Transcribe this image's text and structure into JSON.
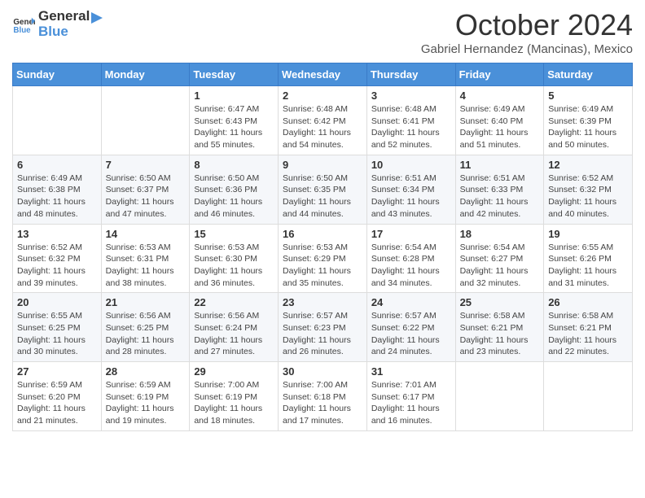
{
  "header": {
    "logo_general": "General",
    "logo_blue": "Blue",
    "month_title": "October 2024",
    "subtitle": "Gabriel Hernandez (Mancinas), Mexico"
  },
  "weekdays": [
    "Sunday",
    "Monday",
    "Tuesday",
    "Wednesday",
    "Thursday",
    "Friday",
    "Saturday"
  ],
  "weeks": [
    [
      {
        "day": "",
        "info": ""
      },
      {
        "day": "",
        "info": ""
      },
      {
        "day": "1",
        "info": "Sunrise: 6:47 AM\nSunset: 6:43 PM\nDaylight: 11 hours and 55 minutes."
      },
      {
        "day": "2",
        "info": "Sunrise: 6:48 AM\nSunset: 6:42 PM\nDaylight: 11 hours and 54 minutes."
      },
      {
        "day": "3",
        "info": "Sunrise: 6:48 AM\nSunset: 6:41 PM\nDaylight: 11 hours and 52 minutes."
      },
      {
        "day": "4",
        "info": "Sunrise: 6:49 AM\nSunset: 6:40 PM\nDaylight: 11 hours and 51 minutes."
      },
      {
        "day": "5",
        "info": "Sunrise: 6:49 AM\nSunset: 6:39 PM\nDaylight: 11 hours and 50 minutes."
      }
    ],
    [
      {
        "day": "6",
        "info": "Sunrise: 6:49 AM\nSunset: 6:38 PM\nDaylight: 11 hours and 48 minutes."
      },
      {
        "day": "7",
        "info": "Sunrise: 6:50 AM\nSunset: 6:37 PM\nDaylight: 11 hours and 47 minutes."
      },
      {
        "day": "8",
        "info": "Sunrise: 6:50 AM\nSunset: 6:36 PM\nDaylight: 11 hours and 46 minutes."
      },
      {
        "day": "9",
        "info": "Sunrise: 6:50 AM\nSunset: 6:35 PM\nDaylight: 11 hours and 44 minutes."
      },
      {
        "day": "10",
        "info": "Sunrise: 6:51 AM\nSunset: 6:34 PM\nDaylight: 11 hours and 43 minutes."
      },
      {
        "day": "11",
        "info": "Sunrise: 6:51 AM\nSunset: 6:33 PM\nDaylight: 11 hours and 42 minutes."
      },
      {
        "day": "12",
        "info": "Sunrise: 6:52 AM\nSunset: 6:32 PM\nDaylight: 11 hours and 40 minutes."
      }
    ],
    [
      {
        "day": "13",
        "info": "Sunrise: 6:52 AM\nSunset: 6:32 PM\nDaylight: 11 hours and 39 minutes."
      },
      {
        "day": "14",
        "info": "Sunrise: 6:53 AM\nSunset: 6:31 PM\nDaylight: 11 hours and 38 minutes."
      },
      {
        "day": "15",
        "info": "Sunrise: 6:53 AM\nSunset: 6:30 PM\nDaylight: 11 hours and 36 minutes."
      },
      {
        "day": "16",
        "info": "Sunrise: 6:53 AM\nSunset: 6:29 PM\nDaylight: 11 hours and 35 minutes."
      },
      {
        "day": "17",
        "info": "Sunrise: 6:54 AM\nSunset: 6:28 PM\nDaylight: 11 hours and 34 minutes."
      },
      {
        "day": "18",
        "info": "Sunrise: 6:54 AM\nSunset: 6:27 PM\nDaylight: 11 hours and 32 minutes."
      },
      {
        "day": "19",
        "info": "Sunrise: 6:55 AM\nSunset: 6:26 PM\nDaylight: 11 hours and 31 minutes."
      }
    ],
    [
      {
        "day": "20",
        "info": "Sunrise: 6:55 AM\nSunset: 6:25 PM\nDaylight: 11 hours and 30 minutes."
      },
      {
        "day": "21",
        "info": "Sunrise: 6:56 AM\nSunset: 6:25 PM\nDaylight: 11 hours and 28 minutes."
      },
      {
        "day": "22",
        "info": "Sunrise: 6:56 AM\nSunset: 6:24 PM\nDaylight: 11 hours and 27 minutes."
      },
      {
        "day": "23",
        "info": "Sunrise: 6:57 AM\nSunset: 6:23 PM\nDaylight: 11 hours and 26 minutes."
      },
      {
        "day": "24",
        "info": "Sunrise: 6:57 AM\nSunset: 6:22 PM\nDaylight: 11 hours and 24 minutes."
      },
      {
        "day": "25",
        "info": "Sunrise: 6:58 AM\nSunset: 6:21 PM\nDaylight: 11 hours and 23 minutes."
      },
      {
        "day": "26",
        "info": "Sunrise: 6:58 AM\nSunset: 6:21 PM\nDaylight: 11 hours and 22 minutes."
      }
    ],
    [
      {
        "day": "27",
        "info": "Sunrise: 6:59 AM\nSunset: 6:20 PM\nDaylight: 11 hours and 21 minutes."
      },
      {
        "day": "28",
        "info": "Sunrise: 6:59 AM\nSunset: 6:19 PM\nDaylight: 11 hours and 19 minutes."
      },
      {
        "day": "29",
        "info": "Sunrise: 7:00 AM\nSunset: 6:19 PM\nDaylight: 11 hours and 18 minutes."
      },
      {
        "day": "30",
        "info": "Sunrise: 7:00 AM\nSunset: 6:18 PM\nDaylight: 11 hours and 17 minutes."
      },
      {
        "day": "31",
        "info": "Sunrise: 7:01 AM\nSunset: 6:17 PM\nDaylight: 11 hours and 16 minutes."
      },
      {
        "day": "",
        "info": ""
      },
      {
        "day": "",
        "info": ""
      }
    ]
  ]
}
